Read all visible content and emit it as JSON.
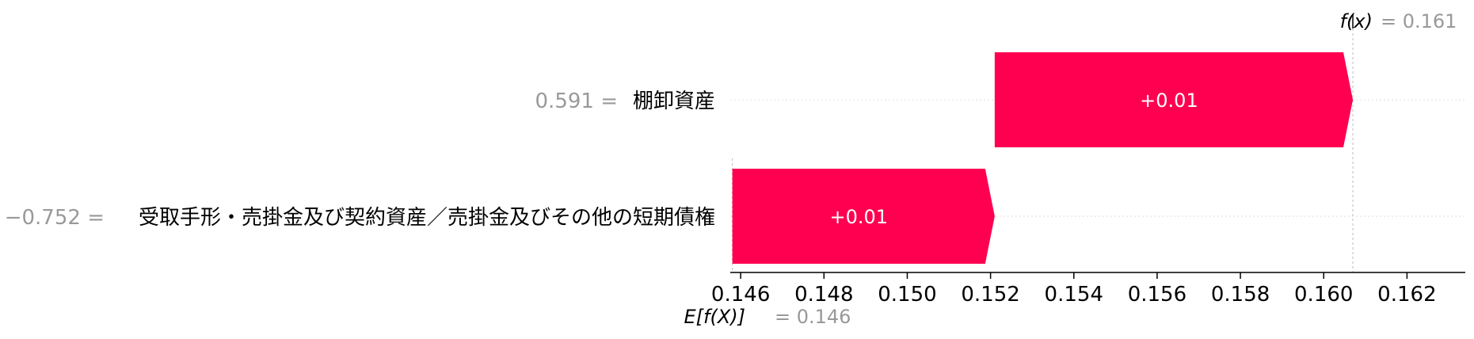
{
  "chart_data": {
    "type": "waterfall",
    "fx": {
      "label": "f(x)",
      "value_text": "= 0.161",
      "value": 0.1607
    },
    "base": {
      "label": "E[f(X)]",
      "value_text": "= 0.146",
      "value": 0.1458
    },
    "features": [
      {
        "value_text": "0.591 =",
        "name": "棚卸資産",
        "start": 0.1521,
        "end": 0.1607,
        "label": "+0.01"
      },
      {
        "value_text": "−0.752 =",
        "name": "受取手形・売掛金及び契約資産／売掛金及びその他の短期債権",
        "start": 0.1458,
        "end": 0.1521,
        "label": "+0.01"
      }
    ],
    "xticks": [
      "0.146",
      "0.148",
      "0.150",
      "0.152",
      "0.154",
      "0.156",
      "0.158",
      "0.160",
      "0.162"
    ],
    "xlim": [
      0.14575,
      0.1634
    ],
    "bar_color": "#ff0051",
    "grid": "horizontal dotted"
  }
}
